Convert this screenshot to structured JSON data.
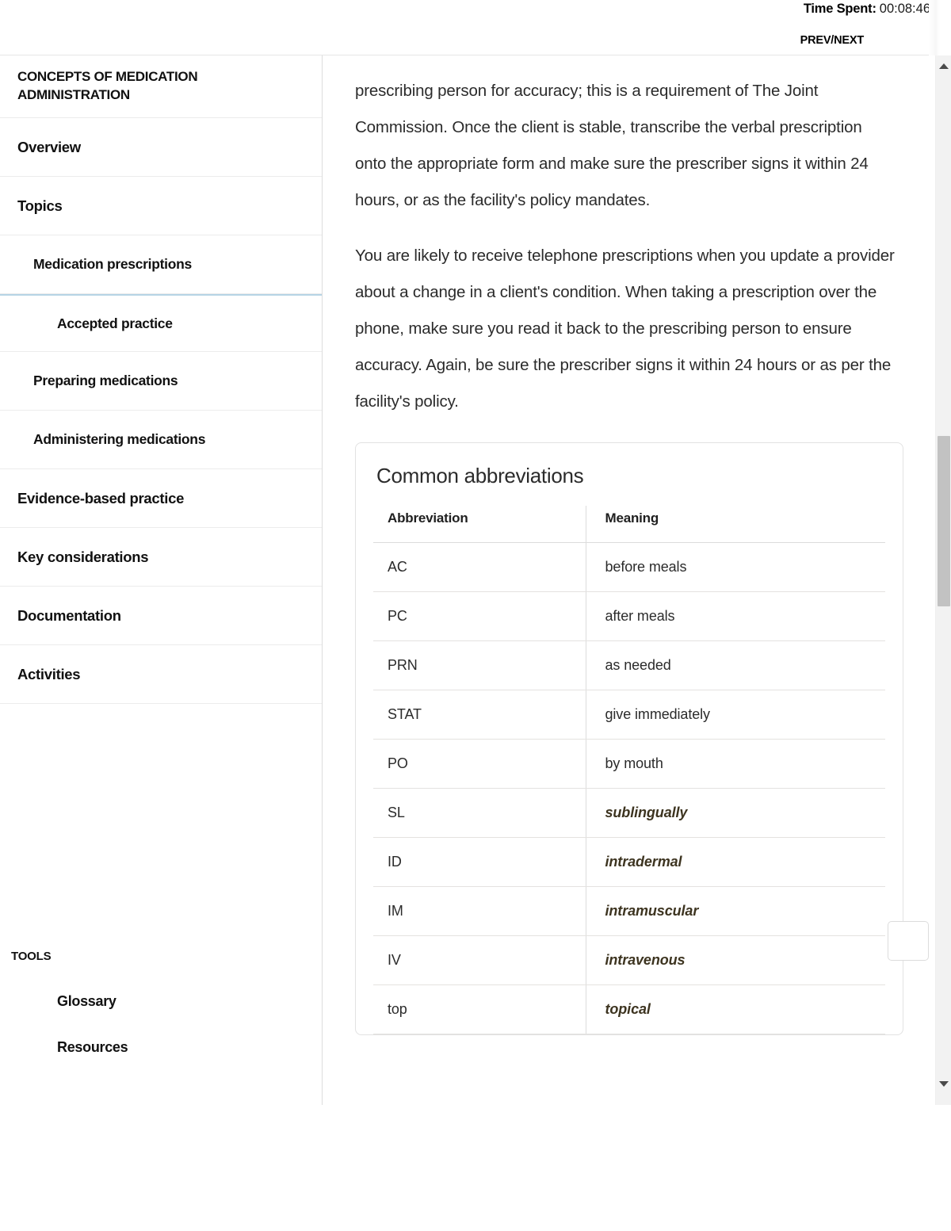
{
  "header": {
    "time_spent_label": "Time Spent:",
    "time_spent_value": "00:08:46",
    "prev_next_label": "PREV/NEXT"
  },
  "sidebar": {
    "course_title": "CONCEPTS OF MEDICATION ADMINISTRATION",
    "items": [
      {
        "label": "Overview",
        "level": 1,
        "active": false
      },
      {
        "label": "Topics",
        "level": 1,
        "active": false
      },
      {
        "label": "Medication prescriptions",
        "level": 2,
        "active": false
      },
      {
        "label": "Accepted practice",
        "level": 3,
        "active": true
      },
      {
        "label": "Preparing medications",
        "level": 2,
        "active": false
      },
      {
        "label": "Administering medications",
        "level": 2,
        "active": false
      },
      {
        "label": "Evidence-based practice",
        "level": 1,
        "active": false
      },
      {
        "label": "Key considerations",
        "level": 1,
        "active": false
      },
      {
        "label": "Documentation",
        "level": 1,
        "active": false
      },
      {
        "label": "Activities",
        "level": 1,
        "active": false
      }
    ],
    "tools_heading": "TOOLS",
    "tools": [
      {
        "label": "Glossary"
      },
      {
        "label": "Resources"
      }
    ]
  },
  "content": {
    "paragraph_1": "prescribing person for accuracy; this is a requirement of The Joint Commission. Once the client is stable, transcribe the verbal prescription onto the appropriate form and make sure the prescriber signs it within 24 hours, or as the facility's policy mandates.",
    "paragraph_2": "You are likely to receive telephone prescriptions when you update a provider about a change in a client's condition. When taking a prescription over the phone, make sure you read it back to the prescribing person to ensure accuracy. Again, be sure the prescriber signs it within 24 hours or as per the facility's policy.",
    "card": {
      "title": "Common abbreviations",
      "columns": [
        "Abbreviation",
        "Meaning"
      ],
      "rows": [
        {
          "abbreviation": "AC",
          "meaning": "before meals",
          "emphasis": false
        },
        {
          "abbreviation": "PC",
          "meaning": "after meals",
          "emphasis": false
        },
        {
          "abbreviation": "PRN",
          "meaning": "as needed",
          "emphasis": false
        },
        {
          "abbreviation": "STAT",
          "meaning": "give immediately",
          "emphasis": false
        },
        {
          "abbreviation": "PO",
          "meaning": "by mouth",
          "emphasis": false
        },
        {
          "abbreviation": "SL",
          "meaning": "sublingually",
          "emphasis": true
        },
        {
          "abbreviation": "ID",
          "meaning": "intradermal",
          "emphasis": true
        },
        {
          "abbreviation": "IM",
          "meaning": "intramuscular",
          "emphasis": true
        },
        {
          "abbreviation": "IV",
          "meaning": "intravenous",
          "emphasis": true
        },
        {
          "abbreviation": "top",
          "meaning": "topical",
          "emphasis": true
        }
      ]
    }
  },
  "scrollbar": {
    "up_arrow_icon": "triangle-up-icon",
    "down_arrow_icon": "triangle-down-icon"
  },
  "colors": {
    "active_nav_underline": "#b6d4e5",
    "emphasis_text": "#3d3420",
    "scroll_thumb": "#c2c2c2",
    "divider": "#ececec"
  }
}
